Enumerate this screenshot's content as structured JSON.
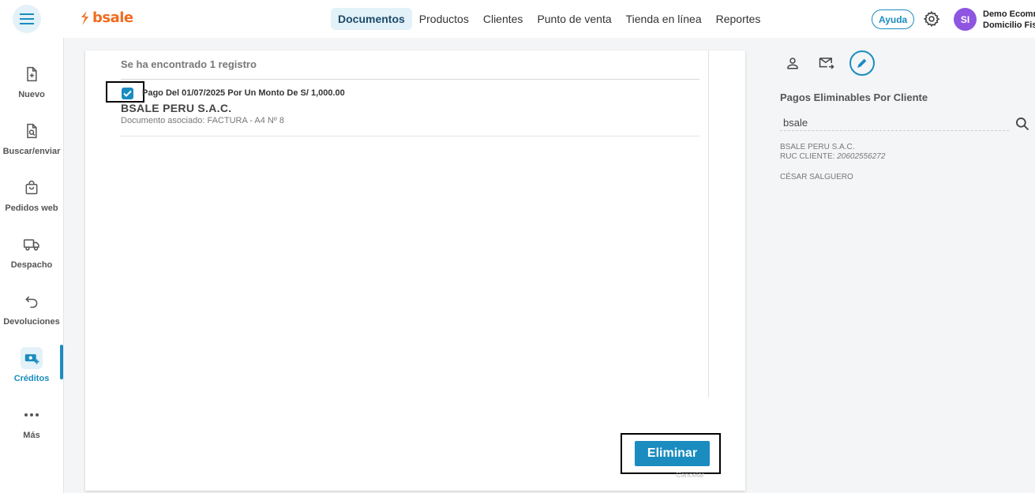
{
  "brand": {
    "name": "bsale",
    "color": "#ef6c1f",
    "accent": "#1a8cc0"
  },
  "nav": {
    "items": [
      "Documentos",
      "Productos",
      "Clientes",
      "Punto de venta",
      "Tienda en línea",
      "Reportes"
    ],
    "active": "Documentos"
  },
  "header": {
    "help_label": "Ayuda",
    "avatar_initials": "SI",
    "account_line1": "Demo Ecommerce",
    "account_line2": "Domicilio Fiscal"
  },
  "sidebar": {
    "items": [
      {
        "label": "Nuevo",
        "icon": "file-plus-icon"
      },
      {
        "label": "Buscar/enviar",
        "icon": "file-search-icon"
      },
      {
        "label": "Pedidos web",
        "icon": "shopping-bag-icon"
      },
      {
        "label": "Despacho",
        "icon": "truck-icon"
      },
      {
        "label": "Devoluciones",
        "icon": "undo-arrow-icon"
      },
      {
        "label": "Créditos",
        "icon": "money-plus-icon",
        "active": true
      },
      {
        "label": "Más",
        "icon": "more-dots-icon"
      }
    ]
  },
  "main": {
    "result_count": "Se ha encontrado 1 registro",
    "record": {
      "checked": true,
      "payment_description": "Pago Del 01/07/2025 Por Un Monto De S/ 1,000.00",
      "client": "BSALE PERU S.A.C.",
      "document": "Documento asociado: FACTURA - A4 Nº 8"
    },
    "delete_label": "Eliminar",
    "cancel_label": "Cancelar"
  },
  "right_panel": {
    "tools": [
      "user-icon",
      "mail-forward-icon",
      "pencil-icon"
    ],
    "title": "Pagos Eliminables Por Cliente",
    "search_value": "bsale",
    "client_name": "BSALE PERU S.A.C.",
    "ruc_label": "RUC CLIENTE:",
    "ruc_value": "20602556272",
    "seller": "CÉSAR SALGUERO"
  }
}
